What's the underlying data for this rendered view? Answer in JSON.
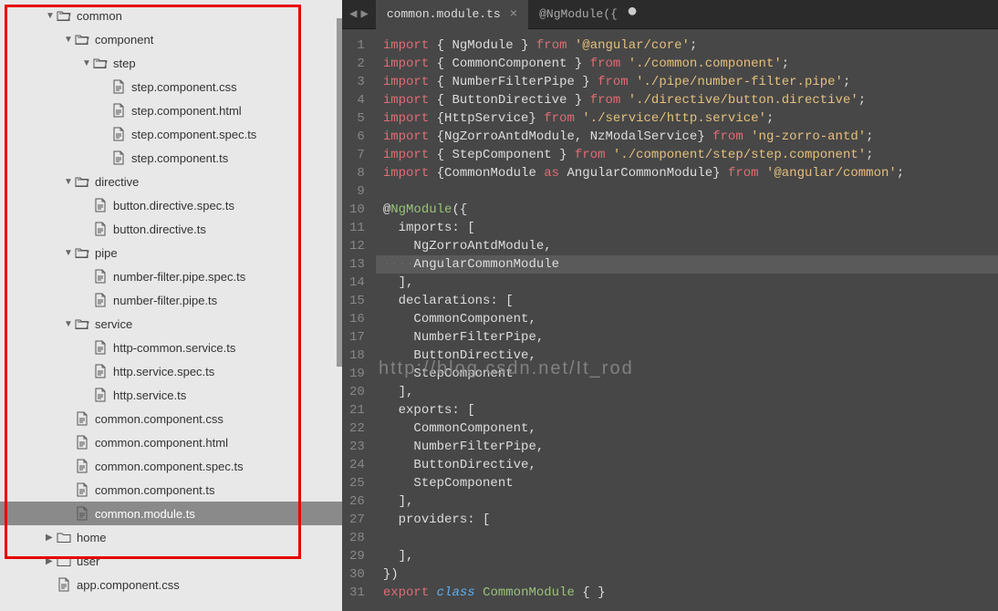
{
  "sidebar": {
    "items": [
      {
        "indent": 1,
        "type": "folder",
        "open": true,
        "chevron": true,
        "label": "common"
      },
      {
        "indent": 2,
        "type": "folder",
        "open": true,
        "chevron": true,
        "label": "component"
      },
      {
        "indent": 3,
        "type": "folder",
        "open": true,
        "chevron": true,
        "label": "step"
      },
      {
        "indent": 4,
        "type": "file",
        "label": "step.component.css"
      },
      {
        "indent": 4,
        "type": "file",
        "label": "step.component.html"
      },
      {
        "indent": 4,
        "type": "file",
        "label": "step.component.spec.ts"
      },
      {
        "indent": 4,
        "type": "file",
        "label": "step.component.ts"
      },
      {
        "indent": 2,
        "type": "folder",
        "open": true,
        "chevron": true,
        "label": "directive"
      },
      {
        "indent": 3,
        "type": "file",
        "label": "button.directive.spec.ts"
      },
      {
        "indent": 3,
        "type": "file",
        "label": "button.directive.ts"
      },
      {
        "indent": 2,
        "type": "folder",
        "open": true,
        "chevron": true,
        "label": "pipe"
      },
      {
        "indent": 3,
        "type": "file",
        "label": "number-filter.pipe.spec.ts"
      },
      {
        "indent": 3,
        "type": "file",
        "label": "number-filter.pipe.ts"
      },
      {
        "indent": 2,
        "type": "folder",
        "open": true,
        "chevron": true,
        "label": "service"
      },
      {
        "indent": 3,
        "type": "file",
        "label": "http-common.service.ts"
      },
      {
        "indent": 3,
        "type": "file",
        "label": "http.service.spec.ts"
      },
      {
        "indent": 3,
        "type": "file",
        "label": "http.service.ts"
      },
      {
        "indent": 2,
        "type": "file",
        "label": "common.component.css"
      },
      {
        "indent": 2,
        "type": "file",
        "label": "common.component.html"
      },
      {
        "indent": 2,
        "type": "file",
        "label": "common.component.spec.ts"
      },
      {
        "indent": 2,
        "type": "file",
        "label": "common.component.ts"
      },
      {
        "indent": 2,
        "type": "file",
        "label": "common.module.ts",
        "selected": true
      },
      {
        "indent": 1,
        "type": "folder",
        "open": false,
        "chevron": true,
        "label": "home"
      },
      {
        "indent": 1,
        "type": "folder",
        "open": false,
        "chevron": true,
        "label": "user"
      },
      {
        "indent": 1,
        "type": "file",
        "label": "app.component.css"
      }
    ]
  },
  "tabs": [
    {
      "label": "common.module.ts",
      "active": true,
      "dirty": false
    },
    {
      "label": "@NgModule({",
      "active": false,
      "dirty": true
    }
  ],
  "code": {
    "watermark": "http://blog.csdn.net/It_rod",
    "lines": [
      {
        "n": 1,
        "tokens": [
          [
            "kw-import",
            "import"
          ],
          [
            "punc",
            " { "
          ],
          [
            "ident",
            "NgModule"
          ],
          [
            "punc",
            " } "
          ],
          [
            "kw-from",
            "from"
          ],
          [
            "punc",
            " "
          ],
          [
            "str",
            "'@angular/core'"
          ],
          [
            "punc",
            ";"
          ]
        ]
      },
      {
        "n": 2,
        "tokens": [
          [
            "kw-import",
            "import"
          ],
          [
            "punc",
            " { "
          ],
          [
            "ident",
            "CommonComponent"
          ],
          [
            "punc",
            " } "
          ],
          [
            "kw-from",
            "from"
          ],
          [
            "punc",
            " "
          ],
          [
            "str",
            "'./common.component'"
          ],
          [
            "punc",
            ";"
          ]
        ]
      },
      {
        "n": 3,
        "tokens": [
          [
            "kw-import",
            "import"
          ],
          [
            "punc",
            " { "
          ],
          [
            "ident",
            "NumberFilterPipe"
          ],
          [
            "punc",
            " } "
          ],
          [
            "kw-from",
            "from"
          ],
          [
            "punc",
            " "
          ],
          [
            "str",
            "'./pipe/number-filter.pipe'"
          ],
          [
            "punc",
            ";"
          ]
        ]
      },
      {
        "n": 4,
        "tokens": [
          [
            "kw-import",
            "import"
          ],
          [
            "punc",
            " { "
          ],
          [
            "ident",
            "ButtonDirective"
          ],
          [
            "punc",
            " } "
          ],
          [
            "kw-from",
            "from"
          ],
          [
            "punc",
            " "
          ],
          [
            "str",
            "'./directive/button.directive'"
          ],
          [
            "punc",
            ";"
          ]
        ]
      },
      {
        "n": 5,
        "tokens": [
          [
            "kw-import",
            "import"
          ],
          [
            "punc",
            " {"
          ],
          [
            "ident",
            "HttpService"
          ],
          [
            "punc",
            "} "
          ],
          [
            "kw-from",
            "from"
          ],
          [
            "punc",
            " "
          ],
          [
            "str",
            "'./service/http.service'"
          ],
          [
            "punc",
            ";"
          ]
        ]
      },
      {
        "n": 6,
        "tokens": [
          [
            "kw-import",
            "import"
          ],
          [
            "punc",
            " {"
          ],
          [
            "ident",
            "NgZorroAntdModule"
          ],
          [
            "punc",
            ", "
          ],
          [
            "ident",
            "NzModalService"
          ],
          [
            "punc",
            "} "
          ],
          [
            "kw-from",
            "from"
          ],
          [
            "punc",
            " "
          ],
          [
            "str",
            "'ng-zorro-antd'"
          ],
          [
            "punc",
            ";"
          ]
        ]
      },
      {
        "n": 7,
        "tokens": [
          [
            "kw-import",
            "import"
          ],
          [
            "punc",
            " { "
          ],
          [
            "ident",
            "StepComponent"
          ],
          [
            "punc",
            " } "
          ],
          [
            "kw-from",
            "from"
          ],
          [
            "punc",
            " "
          ],
          [
            "str",
            "'./component/step/step.component'"
          ],
          [
            "punc",
            ";"
          ]
        ]
      },
      {
        "n": 8,
        "tokens": [
          [
            "kw-import",
            "import"
          ],
          [
            "punc",
            " {"
          ],
          [
            "ident",
            "CommonModule"
          ],
          [
            "punc",
            " "
          ],
          [
            "kw-as",
            "as"
          ],
          [
            "punc",
            " "
          ],
          [
            "ident",
            "AngularCommonModule"
          ],
          [
            "punc",
            "} "
          ],
          [
            "kw-from",
            "from"
          ],
          [
            "punc",
            " "
          ],
          [
            "str",
            "'@angular/common'"
          ],
          [
            "punc",
            ";"
          ]
        ]
      },
      {
        "n": 9,
        "tokens": []
      },
      {
        "n": 10,
        "tokens": [
          [
            "punc",
            "@"
          ],
          [
            "decor",
            "NgModule"
          ],
          [
            "punc",
            "({"
          ]
        ]
      },
      {
        "n": 11,
        "tokens": [
          [
            "punc",
            "  imports: ["
          ]
        ]
      },
      {
        "n": 12,
        "tokens": [
          [
            "punc",
            "    "
          ],
          [
            "ident",
            "NgZorroAntdModule"
          ],
          [
            "punc",
            ","
          ]
        ]
      },
      {
        "n": 13,
        "hl": true,
        "tokens": [
          [
            "dots",
            "····"
          ],
          [
            "ident",
            "AngularCommonModule"
          ]
        ]
      },
      {
        "n": 14,
        "tokens": [
          [
            "punc",
            "  ],"
          ]
        ]
      },
      {
        "n": 15,
        "tokens": [
          [
            "punc",
            "  declarations: ["
          ]
        ]
      },
      {
        "n": 16,
        "tokens": [
          [
            "punc",
            "    "
          ],
          [
            "ident",
            "CommonComponent"
          ],
          [
            "punc",
            ","
          ]
        ]
      },
      {
        "n": 17,
        "tokens": [
          [
            "punc",
            "    "
          ],
          [
            "ident",
            "NumberFilterPipe"
          ],
          [
            "punc",
            ","
          ]
        ]
      },
      {
        "n": 18,
        "tokens": [
          [
            "punc",
            "    "
          ],
          [
            "ident",
            "ButtonDirective"
          ],
          [
            "punc",
            ","
          ]
        ]
      },
      {
        "n": 19,
        "tokens": [
          [
            "punc",
            "    "
          ],
          [
            "ident",
            "StepComponent"
          ]
        ]
      },
      {
        "n": 20,
        "tokens": [
          [
            "punc",
            "  ],"
          ]
        ]
      },
      {
        "n": 21,
        "tokens": [
          [
            "punc",
            "  exports: ["
          ]
        ]
      },
      {
        "n": 22,
        "tokens": [
          [
            "punc",
            "    "
          ],
          [
            "ident",
            "CommonComponent"
          ],
          [
            "punc",
            ","
          ]
        ]
      },
      {
        "n": 23,
        "tokens": [
          [
            "punc",
            "    "
          ],
          [
            "ident",
            "NumberFilterPipe"
          ],
          [
            "punc",
            ","
          ]
        ]
      },
      {
        "n": 24,
        "tokens": [
          [
            "punc",
            "    "
          ],
          [
            "ident",
            "ButtonDirective"
          ],
          [
            "punc",
            ","
          ]
        ]
      },
      {
        "n": 25,
        "tokens": [
          [
            "punc",
            "    "
          ],
          [
            "ident",
            "StepComponent"
          ]
        ]
      },
      {
        "n": 26,
        "tokens": [
          [
            "punc",
            "  ],"
          ]
        ]
      },
      {
        "n": 27,
        "tokens": [
          [
            "punc",
            "  providers: ["
          ]
        ]
      },
      {
        "n": 28,
        "tokens": []
      },
      {
        "n": 29,
        "tokens": [
          [
            "punc",
            "  ],"
          ]
        ]
      },
      {
        "n": 30,
        "tokens": [
          [
            "punc",
            "})"
          ]
        ]
      },
      {
        "n": 31,
        "tokens": [
          [
            "kw-export",
            "export"
          ],
          [
            "punc",
            " "
          ],
          [
            "kw-class",
            "class"
          ],
          [
            "punc",
            " "
          ],
          [
            "classname",
            "CommonModule"
          ],
          [
            "punc",
            " { }"
          ]
        ]
      }
    ]
  }
}
